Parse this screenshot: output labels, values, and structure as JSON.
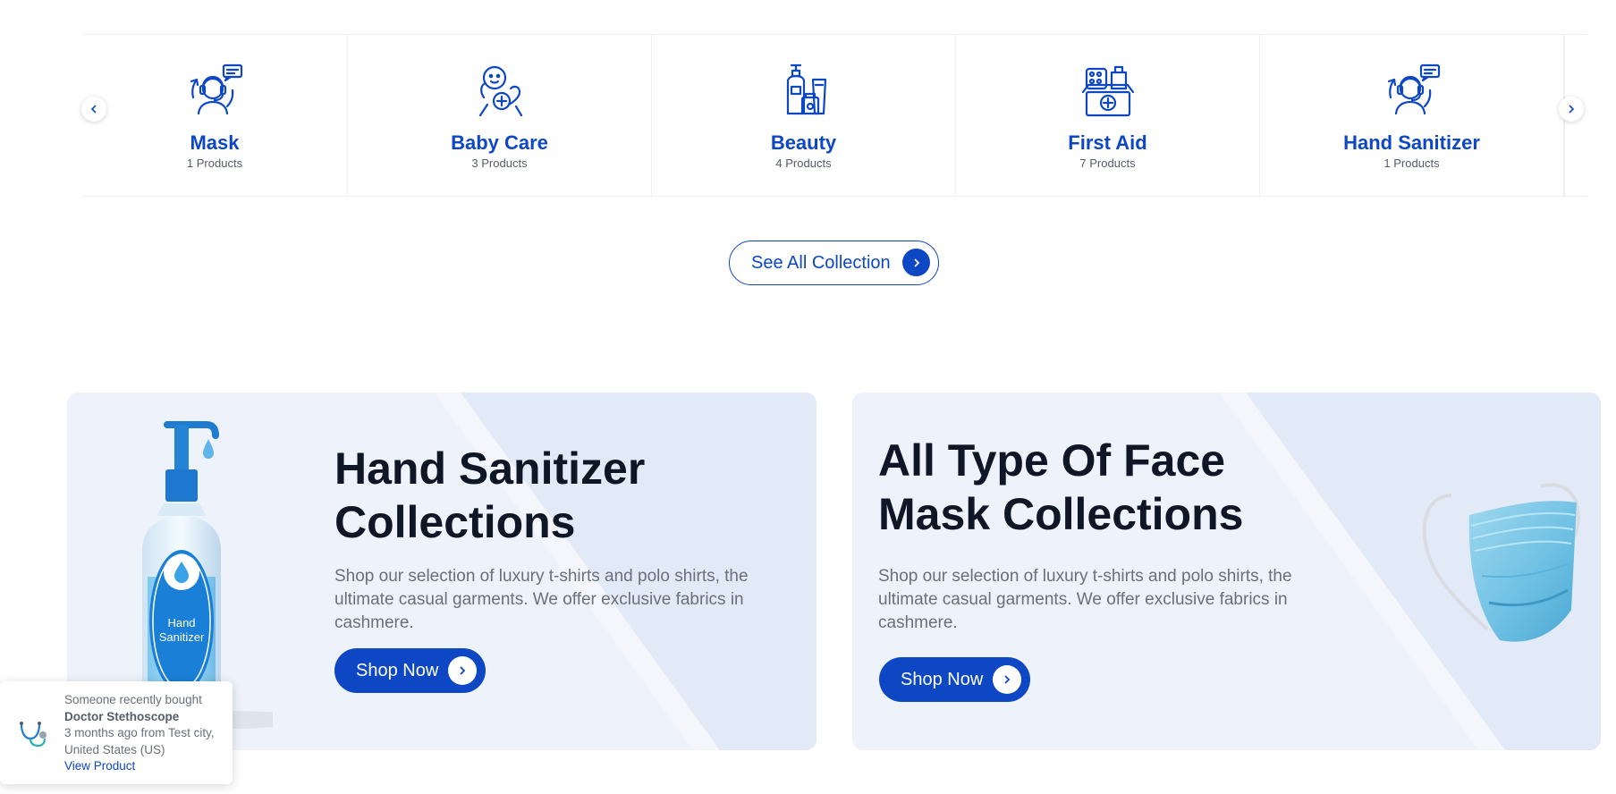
{
  "categories": [
    {
      "name": "Mask",
      "count": "1 Products",
      "icon": "support-agent-icon"
    },
    {
      "name": "Baby Care",
      "count": "3 Products",
      "icon": "baby-care-icon"
    },
    {
      "name": "Beauty",
      "count": "4 Products",
      "icon": "beauty-products-icon"
    },
    {
      "name": "First Aid",
      "count": "7 Products",
      "icon": "first-aid-kit-icon"
    },
    {
      "name": "Hand Sanitizer",
      "count": "1 Products",
      "icon": "support-agent-icon"
    }
  ],
  "see_all": {
    "label": "See All Collection"
  },
  "banners": [
    {
      "title_line1": "Hand Sanitizer",
      "title_line2": "Collections",
      "description": "Shop our selection of luxury t-shirts and polo shirts, the ultimate casual garments. We offer exclusive fabrics in cashmere.",
      "button": "Shop Now",
      "image": "hand-sanitizer-bottle",
      "bottle_label_line1": "Hand",
      "bottle_label_line2": "Sanitizer"
    },
    {
      "title_line1": "All Type Of Face",
      "title_line2": "Mask Collections",
      "description": "Shop our selection of luxury t-shirts and polo shirts, the ultimate casual garments. We offer exclusive fabrics in cashmere.",
      "button": "Shop Now",
      "image": "surgical-face-mask"
    }
  ],
  "toast": {
    "line1": "Someone recently bought",
    "product": "Doctor Stethoscope",
    "time_location": "3 months ago from Test city, United States (US)",
    "link": "View Product",
    "image": "stethoscope-thumbnail"
  },
  "colors": {
    "brand": "#0d47c4",
    "banner_bg": "#eef2fa",
    "heading": "#0f1626",
    "body_text": "#6a6f7b"
  }
}
